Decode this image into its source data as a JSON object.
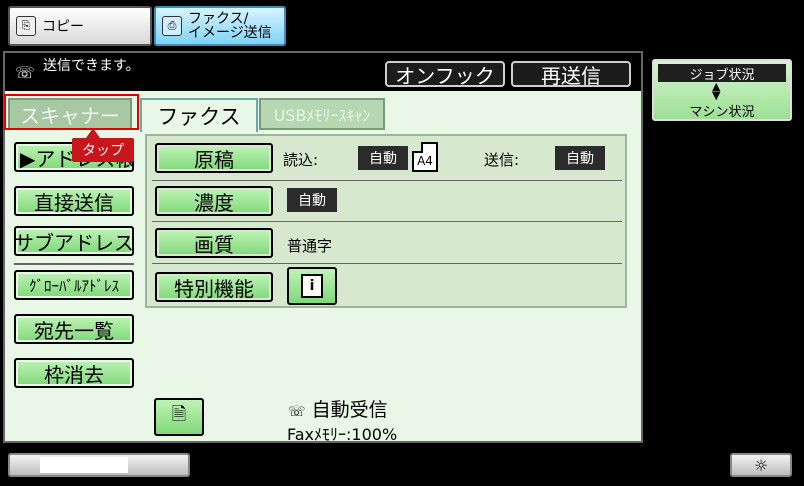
{
  "mode_tabs": {
    "copy": {
      "label": "コピー",
      "icon": "copy-icon"
    },
    "fax": {
      "label_line1": "ファクス/",
      "label_line2": "イメージ送信",
      "icon": "fax-image-icon"
    }
  },
  "status": {
    "message": "送信できます。",
    "onhook_label": "オンフック",
    "resend_label": "再送信"
  },
  "subtabs": {
    "scanner": "スキャナー",
    "fax": "ファクス",
    "usb": "USBﾒﾓﾘｰｽｷｬﾝ"
  },
  "tap_hint": "タップ",
  "left_buttons": {
    "address_book": "▶アドレス帳",
    "direct_send": "直接送信",
    "sub_address": "サブアドレス",
    "global_address": "ｸﾞﾛｰﾊﾞﾙｱﾄﾞﾚｽ",
    "dest_list": "宛先一覧",
    "frame_erase": "枠消去"
  },
  "settings": {
    "original_label": "原稿",
    "read_label": "読込:",
    "read_value": "自動",
    "paper_size": "A4",
    "send_label": "送信:",
    "send_value": "自動",
    "density_label": "濃度",
    "density_value": "自動",
    "quality_label": "画質",
    "quality_value": "普通字",
    "special_label": "特別機能",
    "info_glyph": "i"
  },
  "footer": {
    "auto_receive": "自動受信",
    "fax_memory": "Faxﾒﾓﾘｰ:100%"
  },
  "job_status": {
    "top": "ジョブ状況",
    "bottom": "マシン状況"
  },
  "progress": {
    "fraction": 0.7
  },
  "colors": {
    "accent_green": "#7fd877",
    "highlight_red": "#e00000",
    "fax_tab_blue": "#7fd3f5"
  }
}
